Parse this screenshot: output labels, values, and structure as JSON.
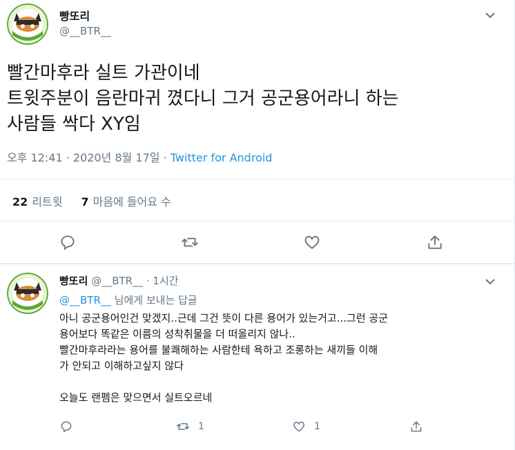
{
  "main_tweet": {
    "display_name": "빵또리",
    "handle": "@__BTR__",
    "text_lines": [
      "빨간마후라 실트 가관이네",
      "트윗주분이 음란마귀 꼈다니 그거 공군용어라니 하는",
      "사람들 싹다 XY임"
    ],
    "time": "오후 12:41",
    "separator": "·",
    "date": "2020년 8월 17일",
    "source": "Twitter for Android",
    "retweet_count": "22",
    "retweet_label": "리트윗",
    "like_count": "7",
    "like_label": "마음에 들어요 수"
  },
  "reply": {
    "display_name": "빵또리",
    "handle": "@__BTR__",
    "separator": "·",
    "time_ago": "1시간",
    "replying_mention": "@__BTR__",
    "replying_text": "님에게 보내는 답글",
    "text_lines": [
      "아니 공군용어인건 맞겠지..근데 그건 뜻이 다른 용어가 있는거고...그런 공군",
      "용어보다 똑같은 이름의 성착취물을 더 떠올리지 않나..",
      "빨간마후라라는 용어를 불쾌해하는 사람한테 욕하고 조롱하는 새끼들 이해",
      "가 안되고 이해하고싶지 않다",
      "",
      "오늘도 랜펨은 맞으면서 실트오르네"
    ],
    "retweet_count": "1",
    "like_count": "1"
  },
  "icons": [
    "chevron-down-icon",
    "reply-icon",
    "retweet-icon",
    "like-icon",
    "share-icon"
  ],
  "colors": {
    "accent": "#1b95e0",
    "muted": "#657786",
    "text": "#14171a",
    "avatar_ring": "#5aa832"
  }
}
